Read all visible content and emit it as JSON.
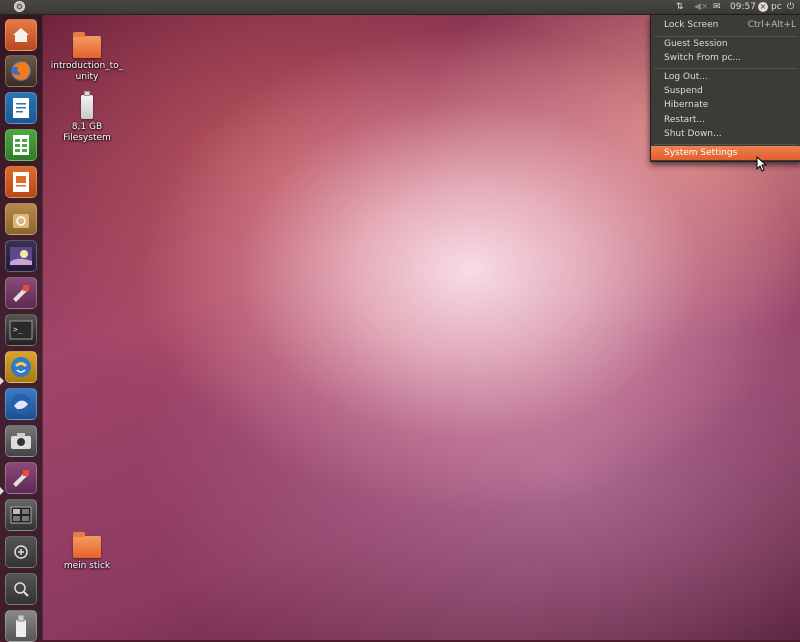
{
  "top_panel": {
    "icons": [
      "ubuntu-logo-icon",
      "network-icon",
      "sound-muted-icon",
      "mail-icon",
      "user-offline-icon",
      "power-icon"
    ],
    "clock": "09:57",
    "user": "pc"
  },
  "launcher": {
    "items": [
      {
        "name": "home-folder"
      },
      {
        "name": "firefox"
      },
      {
        "name": "libreoffice-writer"
      },
      {
        "name": "libreoffice-calc"
      },
      {
        "name": "libreoffice-impress"
      },
      {
        "name": "ubuntu-software-center"
      },
      {
        "name": "shotwell"
      },
      {
        "name": "system-settings"
      },
      {
        "name": "terminal"
      },
      {
        "name": "update-manager"
      },
      {
        "name": "thunderbird"
      },
      {
        "name": "camera"
      },
      {
        "name": "system-settings-2"
      },
      {
        "name": "workspaces"
      },
      {
        "name": "applications-lens"
      },
      {
        "name": "files-lens"
      },
      {
        "name": "usb-drive"
      }
    ]
  },
  "desktop": {
    "icons": [
      {
        "label": "introduction_to_\nunity",
        "icon": "folder-icon"
      },
      {
        "label": "8,1 GB Filesystem",
        "icon": "usb-drive-icon"
      },
      {
        "label": "mein stick",
        "icon": "folder-icon"
      }
    ]
  },
  "session_menu": {
    "items": [
      {
        "label": "Lock Screen",
        "accel": "Ctrl+Alt+L"
      },
      {
        "label": "Guest Session"
      },
      {
        "label": "Switch From pc..."
      },
      {
        "label": "Log Out..."
      },
      {
        "label": "Suspend"
      },
      {
        "label": "Hibernate"
      },
      {
        "label": "Restart..."
      },
      {
        "label": "Shut Down..."
      },
      {
        "label": "System Settings",
        "highlighted": true
      }
    ],
    "highlight_color": "#e9673a"
  }
}
